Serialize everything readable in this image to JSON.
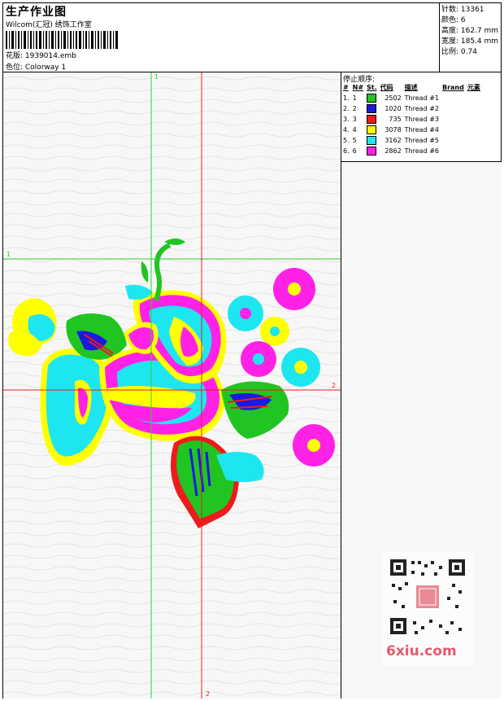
{
  "header": {
    "title": "生产作业图",
    "studio": "Wilcom(汇冠) 绣饰工作室",
    "file": "花版: 1939014.emb",
    "colorway": "色位: Colorway 1"
  },
  "stats": {
    "stitches": "针数: 13361",
    "colors": "颜色: 6",
    "height": "高度: 162.7 mm",
    "width": "宽度: 185.4 mm",
    "scale": "比例: 0.74"
  },
  "threads": {
    "title": "停止顺序:",
    "headers": [
      "#",
      "N#",
      "St.",
      "代码",
      "描述",
      "Brand",
      "元素"
    ],
    "rows": [
      {
        "idx": "1.",
        "n": "1",
        "code": "2502",
        "desc": "Thread #1",
        "color": "#21c521"
      },
      {
        "idx": "2.",
        "n": "2",
        "code": "1020",
        "desc": "Thread #2",
        "color": "#1a1ae0"
      },
      {
        "idx": "3.",
        "n": "3",
        "code": "735",
        "desc": "Thread #3",
        "color": "#ee1b1b"
      },
      {
        "idx": "4.",
        "n": "4",
        "code": "3078",
        "desc": "Thread #4",
        "color": "#ffff00"
      },
      {
        "idx": "5.",
        "n": "5",
        "code": "3162",
        "desc": "Thread #5",
        "color": "#1ee6f0"
      },
      {
        "idx": "6.",
        "n": "6",
        "code": "2862",
        "desc": "Thread #6",
        "color": "#ff22e6"
      }
    ]
  },
  "guides": {
    "v_green": "1",
    "h_green": "1",
    "h_red": "2",
    "v_red": "2",
    "green": "#2cd42c",
    "red": "#e32020"
  },
  "watermark": {
    "text": "6xiu.com"
  }
}
